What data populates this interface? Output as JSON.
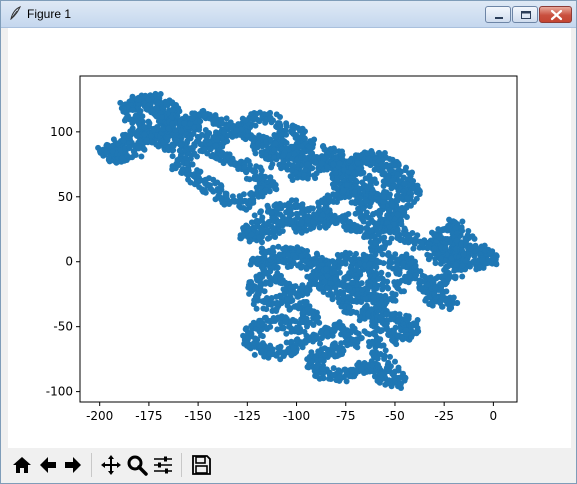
{
  "window": {
    "title": "Figure 1",
    "controls": [
      "minimize",
      "maximize",
      "close"
    ]
  },
  "toolbar": {
    "buttons": [
      {
        "icon": "home-icon",
        "action": "home"
      },
      {
        "icon": "arrow-left-icon",
        "action": "back"
      },
      {
        "icon": "arrow-right-icon",
        "action": "forward"
      },
      {
        "icon": "move-icon",
        "action": "pan"
      },
      {
        "icon": "zoom-icon",
        "action": "zoom"
      },
      {
        "icon": "sliders-icon",
        "action": "configure subplots"
      },
      {
        "icon": "save-icon",
        "action": "save"
      }
    ]
  },
  "chart_data": {
    "type": "scatter",
    "title": "",
    "xlabel": "",
    "ylabel": "",
    "xlim": [
      -210,
      12
    ],
    "ylim": [
      -108,
      143
    ],
    "xticks": [
      "-200",
      "-175",
      "-150",
      "-125",
      "-100",
      "-75",
      "-50",
      "-25",
      "0"
    ],
    "yticks": [
      "-100",
      "-50",
      "0",
      "50",
      "100"
    ],
    "marker_color": "#1f77b4",
    "grid": false,
    "legend": "none",
    "series": [
      {
        "description_of_shape": "2D random walk from origin, points plotted as dots",
        "path": [
          [
            0,
            0
          ],
          [
            -4,
            3
          ],
          [
            -10,
            -5
          ],
          [
            -18,
            2
          ],
          [
            -25,
            10
          ],
          [
            -22,
            -3
          ],
          [
            -30,
            6
          ],
          [
            -26,
            16
          ],
          [
            -18,
            12
          ],
          [
            -12,
            4
          ],
          [
            -20,
            -8
          ],
          [
            -28,
            -14
          ],
          [
            -35,
            -20
          ],
          [
            -30,
            -30
          ],
          [
            -22,
            -34
          ],
          [
            -30,
            -22
          ],
          [
            -38,
            -12
          ],
          [
            -42,
            0
          ],
          [
            -50,
            4
          ],
          [
            -46,
            -12
          ],
          [
            -52,
            -28
          ],
          [
            -60,
            -38
          ],
          [
            -55,
            -52
          ],
          [
            -48,
            -60
          ],
          [
            -40,
            -52
          ],
          [
            -46,
            -45
          ],
          [
            -55,
            -42
          ],
          [
            -62,
            -58
          ],
          [
            -58,
            -72
          ],
          [
            -52,
            -84
          ],
          [
            -48,
            -94
          ],
          [
            -58,
            -88
          ],
          [
            -66,
            -80
          ],
          [
            -72,
            -86
          ],
          [
            -80,
            -88
          ],
          [
            -88,
            -84
          ],
          [
            -92,
            -76
          ],
          [
            -84,
            -70
          ],
          [
            -76,
            -66
          ],
          [
            -70,
            -58
          ],
          [
            -78,
            -50
          ],
          [
            -86,
            -56
          ],
          [
            -96,
            -62
          ],
          [
            -104,
            -68
          ],
          [
            -112,
            -72
          ],
          [
            -120,
            -66
          ],
          [
            -124,
            -58
          ],
          [
            -118,
            -48
          ],
          [
            -108,
            -46
          ],
          [
            -100,
            -52
          ],
          [
            -92,
            -44
          ],
          [
            -96,
            -34
          ],
          [
            -106,
            -30
          ],
          [
            -116,
            -34
          ],
          [
            -122,
            -22
          ],
          [
            -116,
            -12
          ],
          [
            -108,
            -16
          ],
          [
            -100,
            -24
          ],
          [
            -92,
            -18
          ],
          [
            -86,
            -8
          ],
          [
            -90,
            2
          ],
          [
            -98,
            8
          ],
          [
            -106,
            2
          ],
          [
            -114,
            -6
          ],
          [
            -120,
            0
          ],
          [
            -114,
            8
          ],
          [
            -104,
            6
          ],
          [
            -94,
            -2
          ],
          [
            -84,
            -10
          ],
          [
            -76,
            -18
          ],
          [
            -70,
            -28
          ],
          [
            -62,
            -22
          ],
          [
            -56,
            -12
          ],
          [
            -64,
            -4
          ],
          [
            -72,
            4
          ],
          [
            -80,
            -2
          ],
          [
            -86,
            -14
          ],
          [
            -80,
            -26
          ],
          [
            -72,
            -36
          ],
          [
            -64,
            -42
          ],
          [
            -58,
            -32
          ],
          [
            -66,
            -24
          ],
          [
            -74,
            -16
          ],
          [
            -68,
            -6
          ],
          [
            -60,
            2
          ],
          [
            -56,
            14
          ],
          [
            -64,
            22
          ],
          [
            -72,
            28
          ],
          [
            -80,
            36
          ],
          [
            -88,
            30
          ],
          [
            -96,
            38
          ],
          [
            -104,
            44
          ],
          [
            -112,
            38
          ],
          [
            -120,
            30
          ],
          [
            -126,
            22
          ],
          [
            -120,
            18
          ],
          [
            -112,
            26
          ],
          [
            -104,
            34
          ],
          [
            -96,
            26
          ],
          [
            -88,
            40
          ],
          [
            -80,
            50
          ],
          [
            -72,
            58
          ],
          [
            -64,
            52
          ],
          [
            -56,
            44
          ],
          [
            -50,
            36
          ],
          [
            -56,
            26
          ],
          [
            -62,
            32
          ],
          [
            -68,
            44
          ],
          [
            -74,
            56
          ],
          [
            -80,
            66
          ],
          [
            -72,
            74
          ],
          [
            -64,
            80
          ],
          [
            -56,
            72
          ],
          [
            -50,
            62
          ],
          [
            -46,
            52
          ],
          [
            -54,
            46
          ],
          [
            -62,
            60
          ],
          [
            -70,
            68
          ],
          [
            -78,
            78
          ],
          [
            -84,
            86
          ],
          [
            -90,
            76
          ],
          [
            -96,
            66
          ],
          [
            -104,
            72
          ],
          [
            -112,
            80
          ],
          [
            -118,
            88
          ],
          [
            -124,
            98
          ],
          [
            -130,
            104
          ],
          [
            -138,
            96
          ],
          [
            -144,
            88
          ],
          [
            -136,
            80
          ],
          [
            -128,
            74
          ],
          [
            -120,
            66
          ],
          [
            -114,
            58
          ],
          [
            -122,
            50
          ],
          [
            -130,
            44
          ],
          [
            -138,
            52
          ],
          [
            -146,
            60
          ],
          [
            -154,
            68
          ],
          [
            -160,
            76
          ],
          [
            -152,
            84
          ],
          [
            -144,
            92
          ],
          [
            -150,
            102
          ],
          [
            -158,
            108
          ],
          [
            -166,
            112
          ],
          [
            -174,
            118
          ],
          [
            -180,
            124
          ],
          [
            -186,
            120
          ],
          [
            -182,
            110
          ],
          [
            -176,
            102
          ],
          [
            -168,
            96
          ],
          [
            -162,
            104
          ],
          [
            -156,
            96
          ],
          [
            -164,
            88
          ],
          [
            -172,
            96
          ],
          [
            -180,
            100
          ],
          [
            -186,
            94
          ],
          [
            -192,
            88
          ],
          [
            -198,
            86
          ],
          [
            -194,
            80
          ],
          [
            -186,
            82
          ],
          [
            -178,
            90
          ],
          [
            -170,
            104
          ],
          [
            -162,
            118
          ],
          [
            -170,
            126
          ],
          [
            -176,
            122
          ],
          [
            -168,
            112
          ],
          [
            -160,
            102
          ],
          [
            -152,
            110
          ],
          [
            -146,
            114
          ],
          [
            -140,
            106
          ],
          [
            -132,
            100
          ],
          [
            -124,
            108
          ],
          [
            -116,
            112
          ],
          [
            -108,
            104
          ],
          [
            -100,
            98
          ],
          [
            -94,
            90
          ],
          [
            -100,
            82
          ],
          [
            -108,
            88
          ],
          [
            -116,
            96
          ],
          [
            -110,
            88
          ],
          [
            -102,
            82
          ],
          [
            -94,
            78
          ],
          [
            -86,
            74
          ],
          [
            -78,
            70
          ],
          [
            -70,
            76
          ],
          [
            -62,
            82
          ],
          [
            -56,
            78
          ],
          [
            -50,
            70
          ],
          [
            -44,
            62
          ],
          [
            -40,
            54
          ],
          [
            -46,
            42
          ],
          [
            -52,
            32
          ],
          [
            -48,
            22
          ],
          [
            -40,
            16
          ],
          [
            -32,
            12
          ],
          [
            -26,
            22
          ],
          [
            -20,
            30
          ],
          [
            -16,
            18
          ],
          [
            -8,
            10
          ],
          [
            0,
            4
          ]
        ]
      }
    ]
  }
}
